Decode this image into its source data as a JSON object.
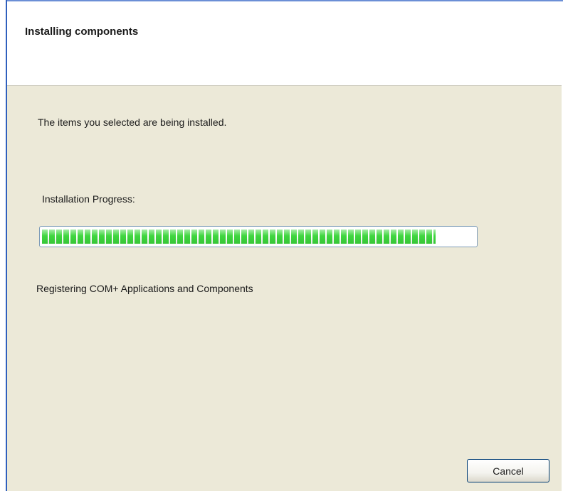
{
  "header": {
    "title": "Installing components"
  },
  "main": {
    "intro_text": "The items you selected are being installed.",
    "progress_label": "Installation Progress:",
    "progress_fraction": 0.91,
    "status_text": "Registering COM+ Applications and Components"
  },
  "buttons": {
    "cancel_label": "Cancel"
  },
  "colors": {
    "progress_green": "#3fd63f",
    "background": "#ece9d8",
    "window_border": "#2f5fbd"
  }
}
